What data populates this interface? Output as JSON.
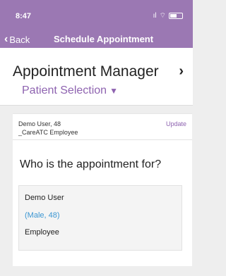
{
  "status_bar": {
    "time": "8:47",
    "signal": "ıl",
    "wifi": "⌔"
  },
  "nav": {
    "back_label": "Back",
    "title": "Schedule Appointment"
  },
  "header": {
    "title": "Appointment Manager",
    "selector_label": "Patient Selection"
  },
  "card": {
    "patient_name": "Demo User, 48",
    "patient_type": "_CareATC Employee",
    "update_label": "Update",
    "question": "Who is the appointment for?",
    "option": {
      "name": "Demo User",
      "info": "(Male, 48)",
      "role": "Employee"
    }
  },
  "colors": {
    "brand": "#9b78b3",
    "accent": "#8e63b0",
    "link": "#3b96d2"
  }
}
